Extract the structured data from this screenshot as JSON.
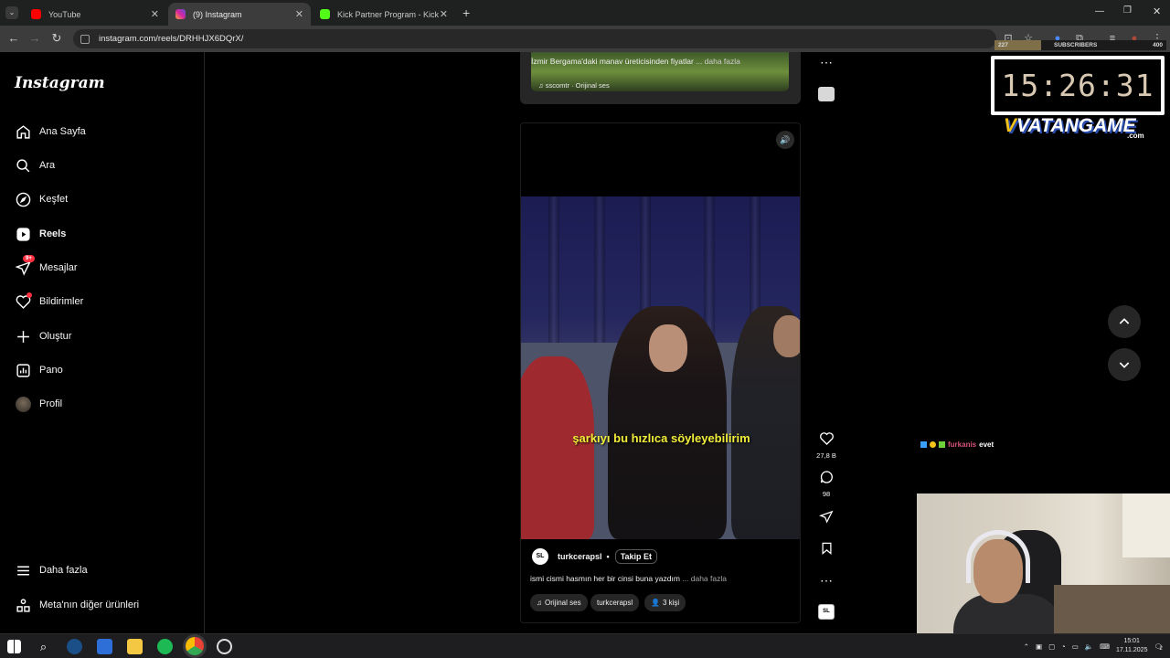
{
  "browser": {
    "tabs": [
      {
        "title": "YouTube",
        "favicon_color": "#ff0000"
      },
      {
        "title": "(9) Instagram",
        "favicon_color": "#d6249f"
      },
      {
        "title": "Kick Partner Program - Kick Da",
        "favicon_color": "#53fc18"
      }
    ],
    "url": "instagram.com/reels/DRHHJX6DQrX/"
  },
  "sidebar": {
    "logo": "Instagram",
    "items": [
      {
        "label": "Ana Sayfa",
        "icon": "home-icon"
      },
      {
        "label": "Ara",
        "icon": "search-icon"
      },
      {
        "label": "Keşfet",
        "icon": "compass-icon"
      },
      {
        "label": "Reels",
        "icon": "reels-icon"
      },
      {
        "label": "Mesajlar",
        "icon": "messages-icon",
        "badge": "9+"
      },
      {
        "label": "Bildirimler",
        "icon": "heart-icon"
      },
      {
        "label": "Oluştur",
        "icon": "plus-icon"
      },
      {
        "label": "Pano",
        "icon": "dashboard-icon"
      },
      {
        "label": "Profil",
        "icon": "avatar"
      }
    ],
    "bottom": [
      {
        "label": "Daha fazla",
        "icon": "menu-icon"
      },
      {
        "label": "Meta'nın diğer ürünleri",
        "icon": "meta-apps-icon"
      }
    ]
  },
  "prev_reel": {
    "caption": "İzmir Bergama'daki manav üreticisinden fiyatlar",
    "more": "... daha fazla",
    "audio": "sscomtr · Orijinal ses"
  },
  "reel": {
    "subtitle": "şarkıyı bu hızlıca söyleyebilirim",
    "author": "turkcerapsl",
    "avatar_text": "SL",
    "follow": "Takip Et",
    "separator": "•",
    "caption": "ismi cismi hasmın her bir cinsi buna yazdım",
    "more": "... daha fazla",
    "audio": "Orijinal ses",
    "audio_user": "turkcerapsl",
    "people": "3 kişi",
    "likes": "27,8 B",
    "comments": "98"
  },
  "overlay": {
    "sub_left": "227",
    "sub_label": "SUBSCRIBERS",
    "sub_right": "400",
    "sub_progress": 0.27,
    "clock": "15:26:31",
    "brand_v": "V",
    "brand": "VATANGAME",
    "brand_com": ".com",
    "chat_user": "furkanis",
    "chat_msg": "evet"
  },
  "taskbar": {
    "time": "15:01",
    "date": "17.11.2025",
    "notifications": "2"
  }
}
